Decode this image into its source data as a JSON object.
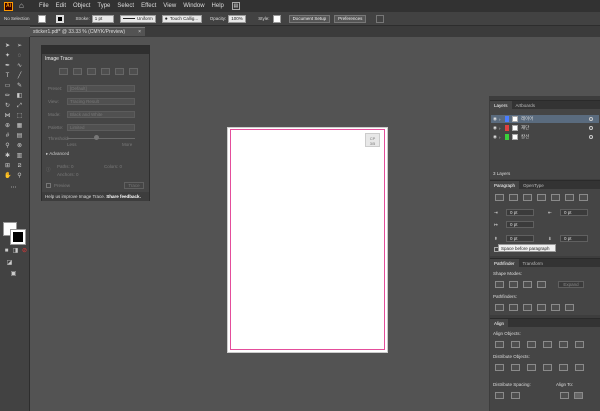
{
  "menubar": {
    "logo": "Ai",
    "items": [
      "File",
      "Edit",
      "Object",
      "Type",
      "Select",
      "Effect",
      "View",
      "Window",
      "Help"
    ]
  },
  "control_bar": {
    "selection": "No Selection",
    "stroke_label": "Stroke:",
    "stroke_value": "1 pt",
    "stroke_profile": "Uniform",
    "brush": "Touch Callig...",
    "opacity_label": "Opacity:",
    "opacity_value": "100%",
    "style_label": "Style:",
    "document_setup": "Document Setup",
    "preferences": "Preferences"
  },
  "document_tab": {
    "title": "sticker1.pdf* @ 33.33 % (CMYK/Preview)"
  },
  "image_trace": {
    "title": "Image Trace",
    "preset_label": "Preset:",
    "preset_value": "[Default]",
    "view_label": "View:",
    "view_value": "Tracing Result",
    "mode_label": "Mode:",
    "mode_value": "Black and White",
    "palette_label": "Palette:",
    "palette_value": "Limited",
    "threshold_label": "Threshold:",
    "less": "Less",
    "more": "More",
    "advanced": "Advanced",
    "paths_label": "Paths:",
    "paths_value": "0",
    "colors_label": "Colors:",
    "colors_value": "0",
    "anchors_label": "Anchors:",
    "anchors_value": "0",
    "preview": "Preview",
    "trace_button": "Trace",
    "help_text": "Help us improve Image Trace.",
    "share_feedback": "Share feedback."
  },
  "artboard_badge": "CP\n3/5",
  "layers_panel": {
    "tabs": [
      "Layers",
      "Artboards"
    ],
    "layers": [
      {
        "name": "레이어",
        "color": "#4a7dff"
      },
      {
        "name": "재단",
        "color": "#e04040"
      },
      {
        "name": "칼선",
        "color": "#3ad03a"
      }
    ],
    "count": "3 Layers"
  },
  "paragraph_panel": {
    "tabs": [
      "Paragraph",
      "OpenType"
    ],
    "left_indent": "0 pt",
    "right_indent": "0 pt",
    "first_line_indent": "0 pt",
    "space_before": "0 pt",
    "space_after": "0 pt",
    "tooltip": "Space before paragraph"
  },
  "pathfinder_panel": {
    "tabs": [
      "Pathfinder",
      "Transform"
    ],
    "shape_modes": "Shape Modes:",
    "expand": "Expand",
    "pathfinders": "Pathfinders:"
  },
  "align_panel": {
    "title": "Align",
    "align_objects": "Align Objects:",
    "distribute_objects": "Distribute Objects:",
    "distribute_spacing": "Distribute Spacing:",
    "align_to": "Align To:"
  },
  "colors": {
    "accent": "#ff9a00",
    "bleed": "#e44d9b",
    "canvas": "#535353"
  }
}
